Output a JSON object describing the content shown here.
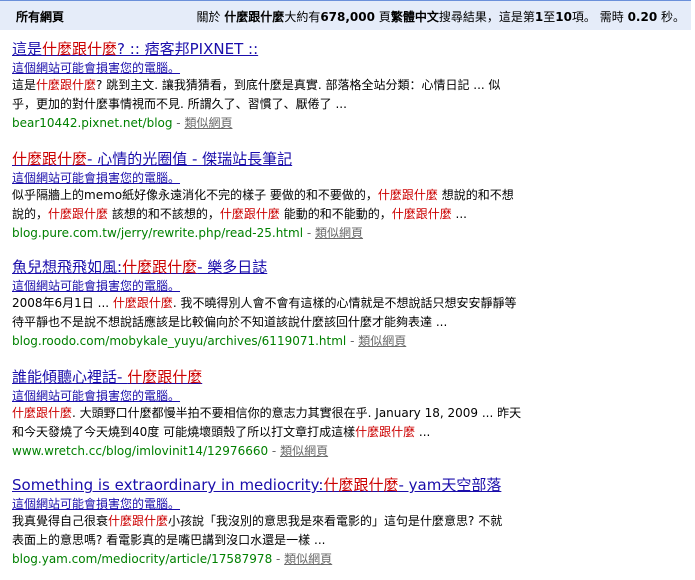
{
  "header": {
    "left": "所有網頁",
    "right": {
      "p1": "關於 ",
      "q": "什麼跟什麼",
      "p2": "大約有",
      "count": "678,000",
      "p3": " 頁",
      "lang": "繁體中文",
      "p4": "搜尋結果，這是第",
      "from": "1",
      "p5": "至",
      "to": "10",
      "p6": "項。 需時 ",
      "time": "0.20",
      "p7": " 秒。"
    }
  },
  "results": [
    {
      "title": [
        {
          "t": "這是"
        },
        {
          "t": "什麼跟什麼",
          "hl": true
        },
        {
          "t": "? :: 痞客邦PIXNET ::"
        }
      ],
      "warning": "這個網站可能會損害您的電腦。",
      "lines": [
        [
          {
            "t": "這是"
          },
          {
            "t": "什麼跟什麼",
            "hl": true
          },
          {
            "t": "? 跳到主文. 讓我猜猜看，到底什麼是真實. 部落格全站分類：心情日記 ... 似"
          }
        ],
        [
          {
            "t": "乎，更加的對什麼事情視而不見. 所謂久了、習慣了、厭倦了 ..."
          }
        ]
      ],
      "url": "bear10442.pixnet.net/blog",
      "similar": "類似網頁"
    },
    {
      "title": [
        {
          "t": "什麼跟什麼",
          "hl": true
        },
        {
          "t": "- 心情的光圈值 - 傑瑞站長筆記"
        }
      ],
      "warning": "這個網站可能會損害您的電腦。",
      "lines": [
        [
          {
            "t": "似乎隔牆上的memo紙好像永遠消化不完的樣子 要做的和不要做的，"
          },
          {
            "t": "什麼跟什麼",
            "hl": true
          },
          {
            "t": " 想說的和不想"
          }
        ],
        [
          {
            "t": "說的，"
          },
          {
            "t": "什麼跟什麼",
            "hl": true
          },
          {
            "t": " 該想的和不該想的，"
          },
          {
            "t": "什麼跟什麼",
            "hl": true
          },
          {
            "t": " 能動的和不能動的，"
          },
          {
            "t": "什麼跟什麼",
            "hl": true
          },
          {
            "t": " ..."
          }
        ]
      ],
      "url": "blog.pure.com.tw/jerry/rewrite.php/read-25.html",
      "similar": "類似網頁"
    },
    {
      "title": [
        {
          "t": "魚兒想飛飛如風:"
        },
        {
          "t": "什麼跟什麼",
          "hl": true
        },
        {
          "t": "- 樂多日誌"
        }
      ],
      "warning": "這個網站可能會損害您的電腦。",
      "lines": [
        [
          {
            "t": "2008年6月1日 ... "
          },
          {
            "t": "什麼跟什麼",
            "hl": true
          },
          {
            "t": ". 我不曉得別人會不會有這樣的心情就是不想說話只想安安靜靜等"
          }
        ],
        [
          {
            "t": "待平靜也不是說不想說話應該是比較偏向於不知道該說什麼該回什麼才能夠表達 ..."
          }
        ]
      ],
      "url": "blog.roodo.com/mobykale_yuyu/archives/6119071.html",
      "similar": "類似網頁"
    },
    {
      "title": [
        {
          "t": "誰能傾聽心裡話- "
        },
        {
          "t": "什麼跟什麼",
          "hl": true
        }
      ],
      "warning": "這個網站可能會損害您的電腦。",
      "lines": [
        [
          {
            "t": "什麼跟什麼",
            "hl": true
          },
          {
            "t": ". 大頭野口什麼都慢半拍不要相信你的意志力其實很在乎. January 18, 2009 ... 昨天"
          }
        ],
        [
          {
            "t": "和今天發燒了今天燒到40度 可能燒壞頭殼了所以打文章打成這樣"
          },
          {
            "t": "什麼跟什麼",
            "hl": true
          },
          {
            "t": " ..."
          }
        ]
      ],
      "url": "www.wretch.cc/blog/imlovinit14/12976660",
      "similar": "類似網頁"
    },
    {
      "title": [
        {
          "t": "Something is extraordinary in mediocrity:"
        },
        {
          "t": "什麼跟什麼",
          "hl": true
        },
        {
          "t": "- yam天空部落"
        }
      ],
      "warning": "這個網站可能會損害您的電腦。",
      "lines": [
        [
          {
            "t": "我真覺得自己很衰"
          },
          {
            "t": "什麼跟什麼",
            "hl": true
          },
          {
            "t": "小孩說「我沒別的意思我是來看電影的」這句是什麼意思? 不就"
          }
        ],
        [
          {
            "t": "表面上的意思嗎? 看電影真的是嘴巴講到沒口水還是一樣 ..."
          }
        ]
      ],
      "url": "blog.yam.com/mediocrity/article/17587978",
      "similar": "類似網頁"
    }
  ]
}
